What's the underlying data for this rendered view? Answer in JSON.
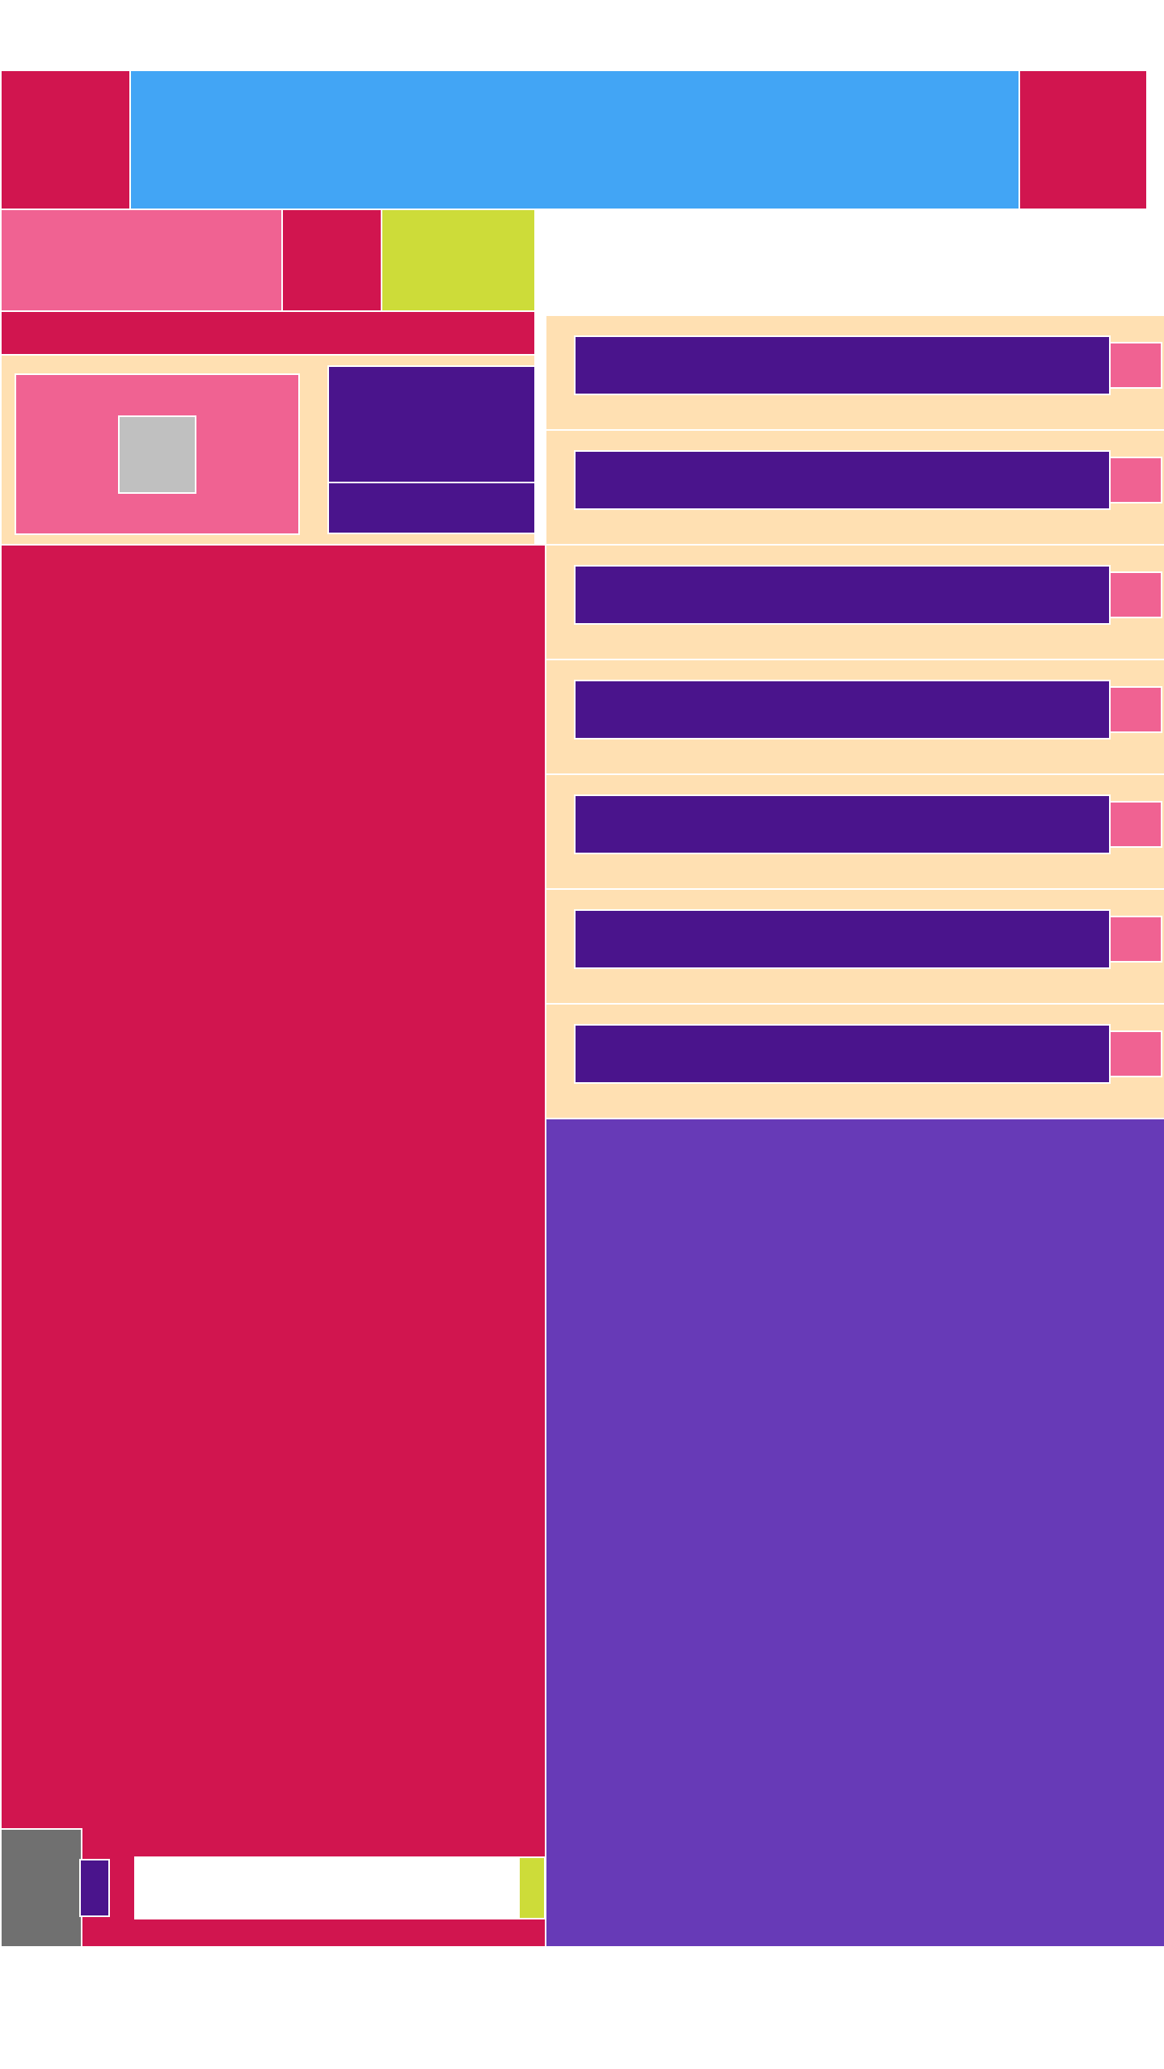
{
  "colors": {
    "background": "#ffffff",
    "crimson": "#d1154f",
    "sky_blue": "#42a5f5",
    "pink": "#f06292",
    "lime": "#cddc39",
    "peach": "#ffe0b2",
    "indigo": "#4a148c",
    "violet": "#673ab7",
    "light_gray": "#c0c0c0",
    "dark_gray": "#707070",
    "border": "#ffffff"
  },
  "header": {
    "left_block": "",
    "center_banner": "",
    "right_block": ""
  },
  "toolbar": {
    "pink_tab": "",
    "crimson_tab": "",
    "lime_tab": ""
  },
  "left_panel": {
    "strip": "",
    "card": {
      "preview": "",
      "thumbnail": "",
      "primary_action": "",
      "secondary_action": ""
    },
    "footer": {
      "avatar": "",
      "indicator": "",
      "input_value": "",
      "input_placeholder": "",
      "send_button": ""
    }
  },
  "list": {
    "items": [
      {
        "label": "",
        "action": ""
      },
      {
        "label": "",
        "action": ""
      },
      {
        "label": "",
        "action": ""
      },
      {
        "label": "",
        "action": ""
      },
      {
        "label": "",
        "action": ""
      },
      {
        "label": "",
        "action": ""
      },
      {
        "label": "",
        "action": ""
      }
    ]
  },
  "right_panel": {
    "content": ""
  }
}
